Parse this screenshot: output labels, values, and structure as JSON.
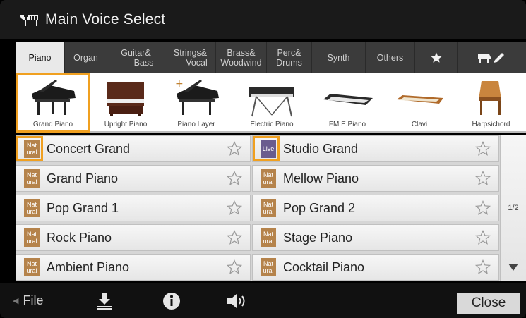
{
  "window": {
    "title": "Main Voice Select"
  },
  "tabs": [
    {
      "line1": "Piano",
      "line2": "",
      "active": true
    },
    {
      "line1": "Organ",
      "line2": "",
      "active": false
    },
    {
      "line1": "Guitar&",
      "line2": "Bass",
      "active": false
    },
    {
      "line1": "Strings&",
      "line2": "Vocal",
      "active": false
    },
    {
      "line1": "Brass&",
      "line2": "Woodwind",
      "active": false
    },
    {
      "line1": "Perc&",
      "line2": "Drums",
      "active": false
    },
    {
      "line1": "Synth",
      "line2": "",
      "active": false
    },
    {
      "line1": "Others",
      "line2": "",
      "active": false
    },
    {
      "icon": "star-icon"
    },
    {
      "icon": "piano-edit-icon"
    }
  ],
  "categories": [
    {
      "label": "Grand Piano",
      "selected": true
    },
    {
      "label": "Upright Piano",
      "selected": false
    },
    {
      "label": "Piano Layer",
      "selected": false
    },
    {
      "label": "Electric Piano",
      "selected": false
    },
    {
      "label": "FM E.Piano",
      "selected": false
    },
    {
      "label": "Clavi",
      "selected": false
    },
    {
      "label": "Harpsichord",
      "selected": false
    }
  ],
  "voices_left": [
    {
      "name": "Concert Grand",
      "badge": "Natural",
      "badge_top": "Nat",
      "badge_bottom": "ural",
      "selected": true
    },
    {
      "name": "Grand Piano",
      "badge": "Natural",
      "badge_top": "Nat",
      "badge_bottom": "ural",
      "selected": false
    },
    {
      "name": "Pop Grand 1",
      "badge": "Natural",
      "badge_top": "Nat",
      "badge_bottom": "ural",
      "selected": false
    },
    {
      "name": "Rock Piano",
      "badge": "Natural",
      "badge_top": "Nat",
      "badge_bottom": "ural",
      "selected": false
    },
    {
      "name": "Ambient Piano",
      "badge": "Natural",
      "badge_top": "Nat",
      "badge_bottom": "ural",
      "selected": false
    }
  ],
  "voices_right": [
    {
      "name": "Studio Grand",
      "badge": "Live",
      "badge_top": "Live",
      "badge_bottom": "",
      "selected": true
    },
    {
      "name": "Mellow Piano",
      "badge": "Natural",
      "badge_top": "Nat",
      "badge_bottom": "ural",
      "selected": false
    },
    {
      "name": "Pop Grand 2",
      "badge": "Natural",
      "badge_top": "Nat",
      "badge_bottom": "ural",
      "selected": false
    },
    {
      "name": "Stage Piano",
      "badge": "Natural",
      "badge_top": "Nat",
      "badge_bottom": "ural",
      "selected": false
    },
    {
      "name": "Cocktail Piano",
      "badge": "Natural",
      "badge_top": "Nat",
      "badge_bottom": "ural",
      "selected": false
    }
  ],
  "pager": {
    "page": "1/2"
  },
  "bottom": {
    "file_label": "File",
    "close_label": "Close",
    "icons": [
      "save-icon",
      "info-icon",
      "speaker-icon"
    ]
  },
  "colors": {
    "selection": "#f0a020",
    "natural_badge": "#b5834b",
    "live_badge": "#6a5c8e",
    "tab_active": "#e9e9e9",
    "tab_inactive": "#3b3b3b"
  }
}
